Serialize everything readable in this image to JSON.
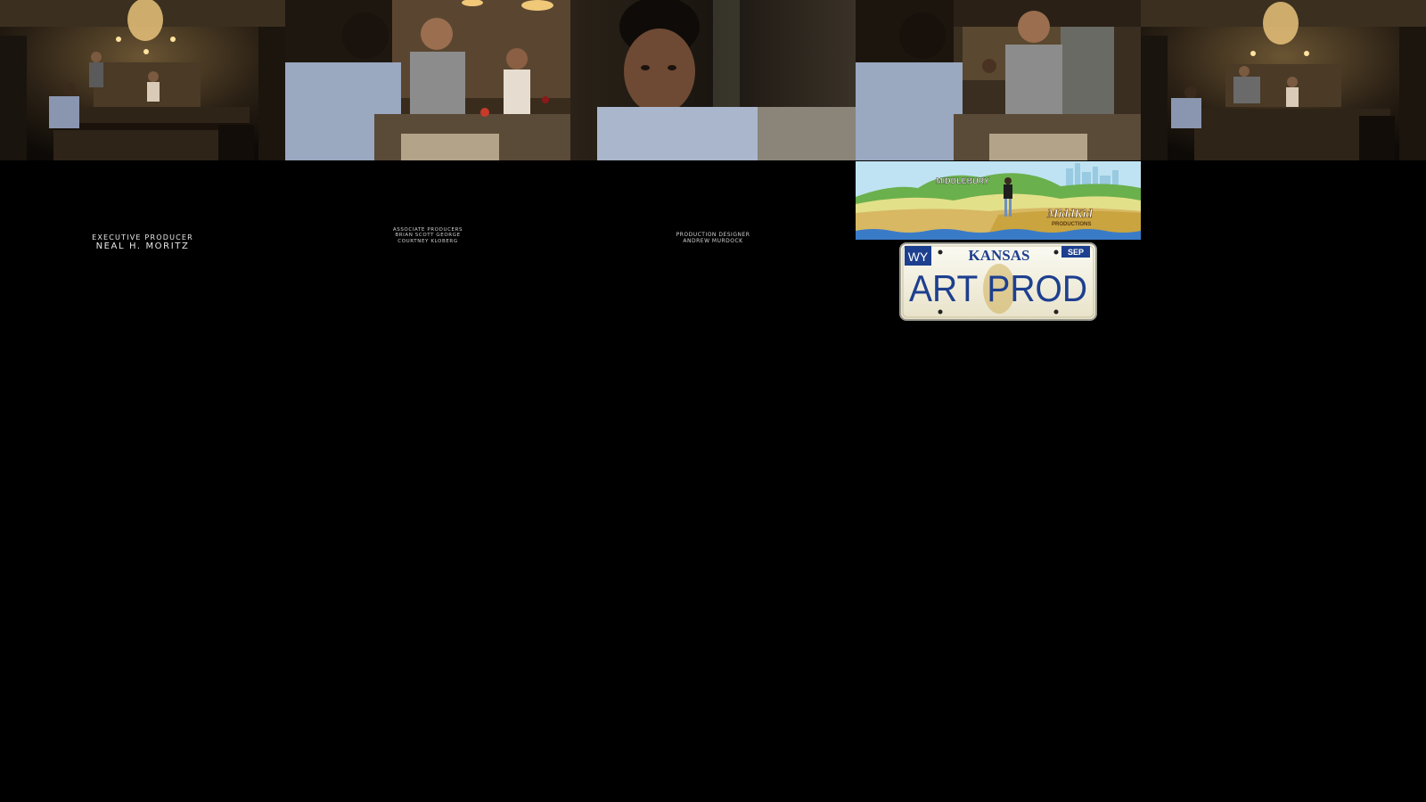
{
  "credits": {
    "executive_producer": {
      "role": "Executive Producer",
      "name": "Neal H. Moritz"
    },
    "associate_producers": {
      "role": "Associate Producers",
      "names": [
        "Brian Scott George",
        "Courtney Kloberg"
      ]
    },
    "production_designer": {
      "role": "Production Designer",
      "name": "Andrew Murdock"
    }
  },
  "logos": {
    "middkid": {
      "sign_text": "MIDDLEBURY",
      "brand": "MiddKid",
      "sub": "PRODUCTIONS"
    },
    "plate": {
      "state": "KANSAS",
      "corner_left": "WY",
      "corner_right": "SEP",
      "text": "ART PROD"
    }
  },
  "colors": {
    "background": "#000000",
    "plate_blue": "#1d3f8f",
    "logo_gold": "#c9a43f"
  }
}
